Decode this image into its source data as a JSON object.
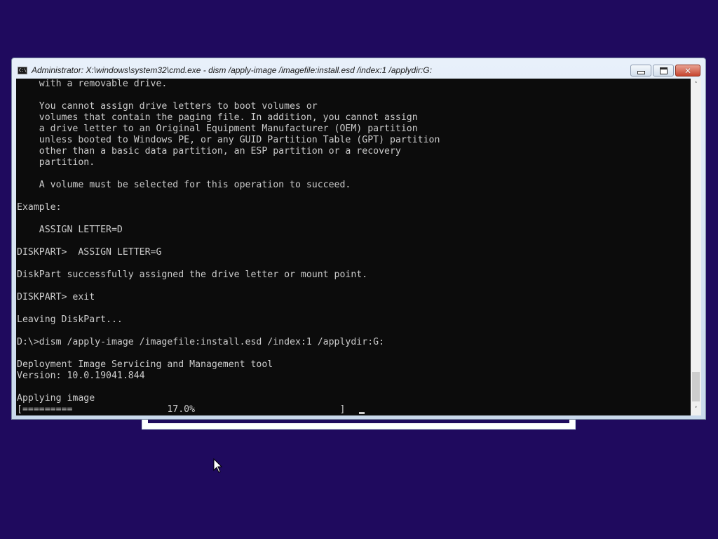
{
  "window": {
    "title": "Administrator: X:\\windows\\system32\\cmd.exe - dism  /apply-image /imagefile:install.esd /index:1 /applydir:G:",
    "icon_text": "C:\\."
  },
  "console": {
    "lines": [
      "    with a removable drive.",
      "",
      "    You cannot assign drive letters to boot volumes or",
      "    volumes that contain the paging file. In addition, you cannot assign",
      "    a drive letter to an Original Equipment Manufacturer (OEM) partition",
      "    unless booted to Windows PE, or any GUID Partition Table (GPT) partition",
      "    other than a basic data partition, an ESP partition or a recovery",
      "    partition.",
      "",
      "    A volume must be selected for this operation to succeed.",
      "",
      "Example:",
      "",
      "    ASSIGN LETTER=D",
      "",
      "DISKPART>  ASSIGN LETTER=G",
      "",
      "DiskPart successfully assigned the drive letter or mount point.",
      "",
      "DISKPART> exit",
      "",
      "Leaving DiskPart...",
      "",
      "D:\\>dism /apply-image /imagefile:install.esd /index:1 /applydir:G:",
      "",
      "Deployment Image Servicing and Management tool",
      "Version: 10.0.19041.844",
      "",
      "Applying image",
      "[=========                 17.0%                          ]"
    ]
  },
  "progress": {
    "percent": 17.0
  },
  "colors": {
    "desktop_background": "#1f0a5e",
    "console_background": "#0c0c0c",
    "console_text": "#cccccc",
    "close_button": "#c7452f"
  },
  "icons": {
    "minimize": "minimize-icon",
    "maximize": "maximize-icon",
    "close": "close-icon",
    "scroll_up": "chevron-up-icon",
    "scroll_down": "chevron-down-icon"
  }
}
